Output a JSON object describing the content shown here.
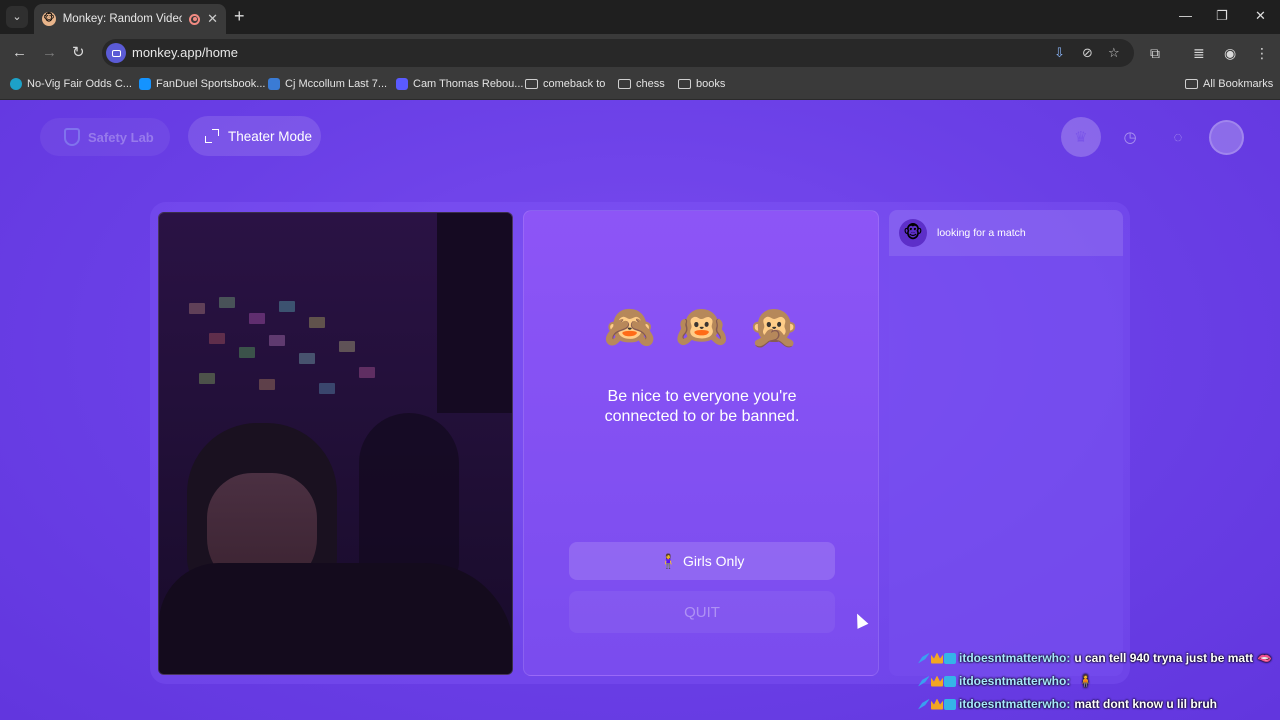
{
  "browser": {
    "tab_title": "Monkey: Random Video Ch",
    "tab_favicon": "🐵",
    "url": "monkey.app/home",
    "bookmarks": [
      {
        "label": "No-Vig Fair Odds C...",
        "icon": "odds-favicon",
        "color": "#1da1c8"
      },
      {
        "label": "FanDuel Sportsbook...",
        "icon": "fanduel-favicon",
        "color": "#1493ff"
      },
      {
        "label": "Cj Mccollum Last 7...",
        "icon": "stats-favicon",
        "color": "#3a7bd5"
      },
      {
        "label": "Cam Thomas Rebou...",
        "icon": "hp-favicon",
        "color": "#5a5aff"
      },
      {
        "label": "comeback to",
        "icon": "folder-icon"
      },
      {
        "label": "chess",
        "icon": "folder-icon"
      },
      {
        "label": "books",
        "icon": "folder-icon"
      }
    ],
    "all_bookmarks_label": "All Bookmarks"
  },
  "page": {
    "safety_lab_label": "Safety Lab",
    "theater_mode_label": "Theater Mode",
    "monkeys": "🙈🙉🙊",
    "notice": "Be nice to everyone you're connected to or be banned.",
    "girls_only_icon": "🧍‍♀️",
    "girls_only_label": "Girls Only",
    "quit_label": "QUIT",
    "status_avatar": "🐵",
    "status_text": "looking for a match"
  },
  "stream_chat": [
    {
      "user": "itdoesntmatterwho:",
      "message": "u can tell 940 tryna just be matt",
      "emoji": "🫦"
    },
    {
      "user": "itdoesntmatterwho:",
      "message": "",
      "emoji": "🧍"
    },
    {
      "user": "itdoesntmatterwho:",
      "message": "matt dont know u lil bruh",
      "emoji": ""
    }
  ],
  "colors": {
    "brand_purple": "#6a3fe6",
    "card_purple": "#8d55f6"
  }
}
